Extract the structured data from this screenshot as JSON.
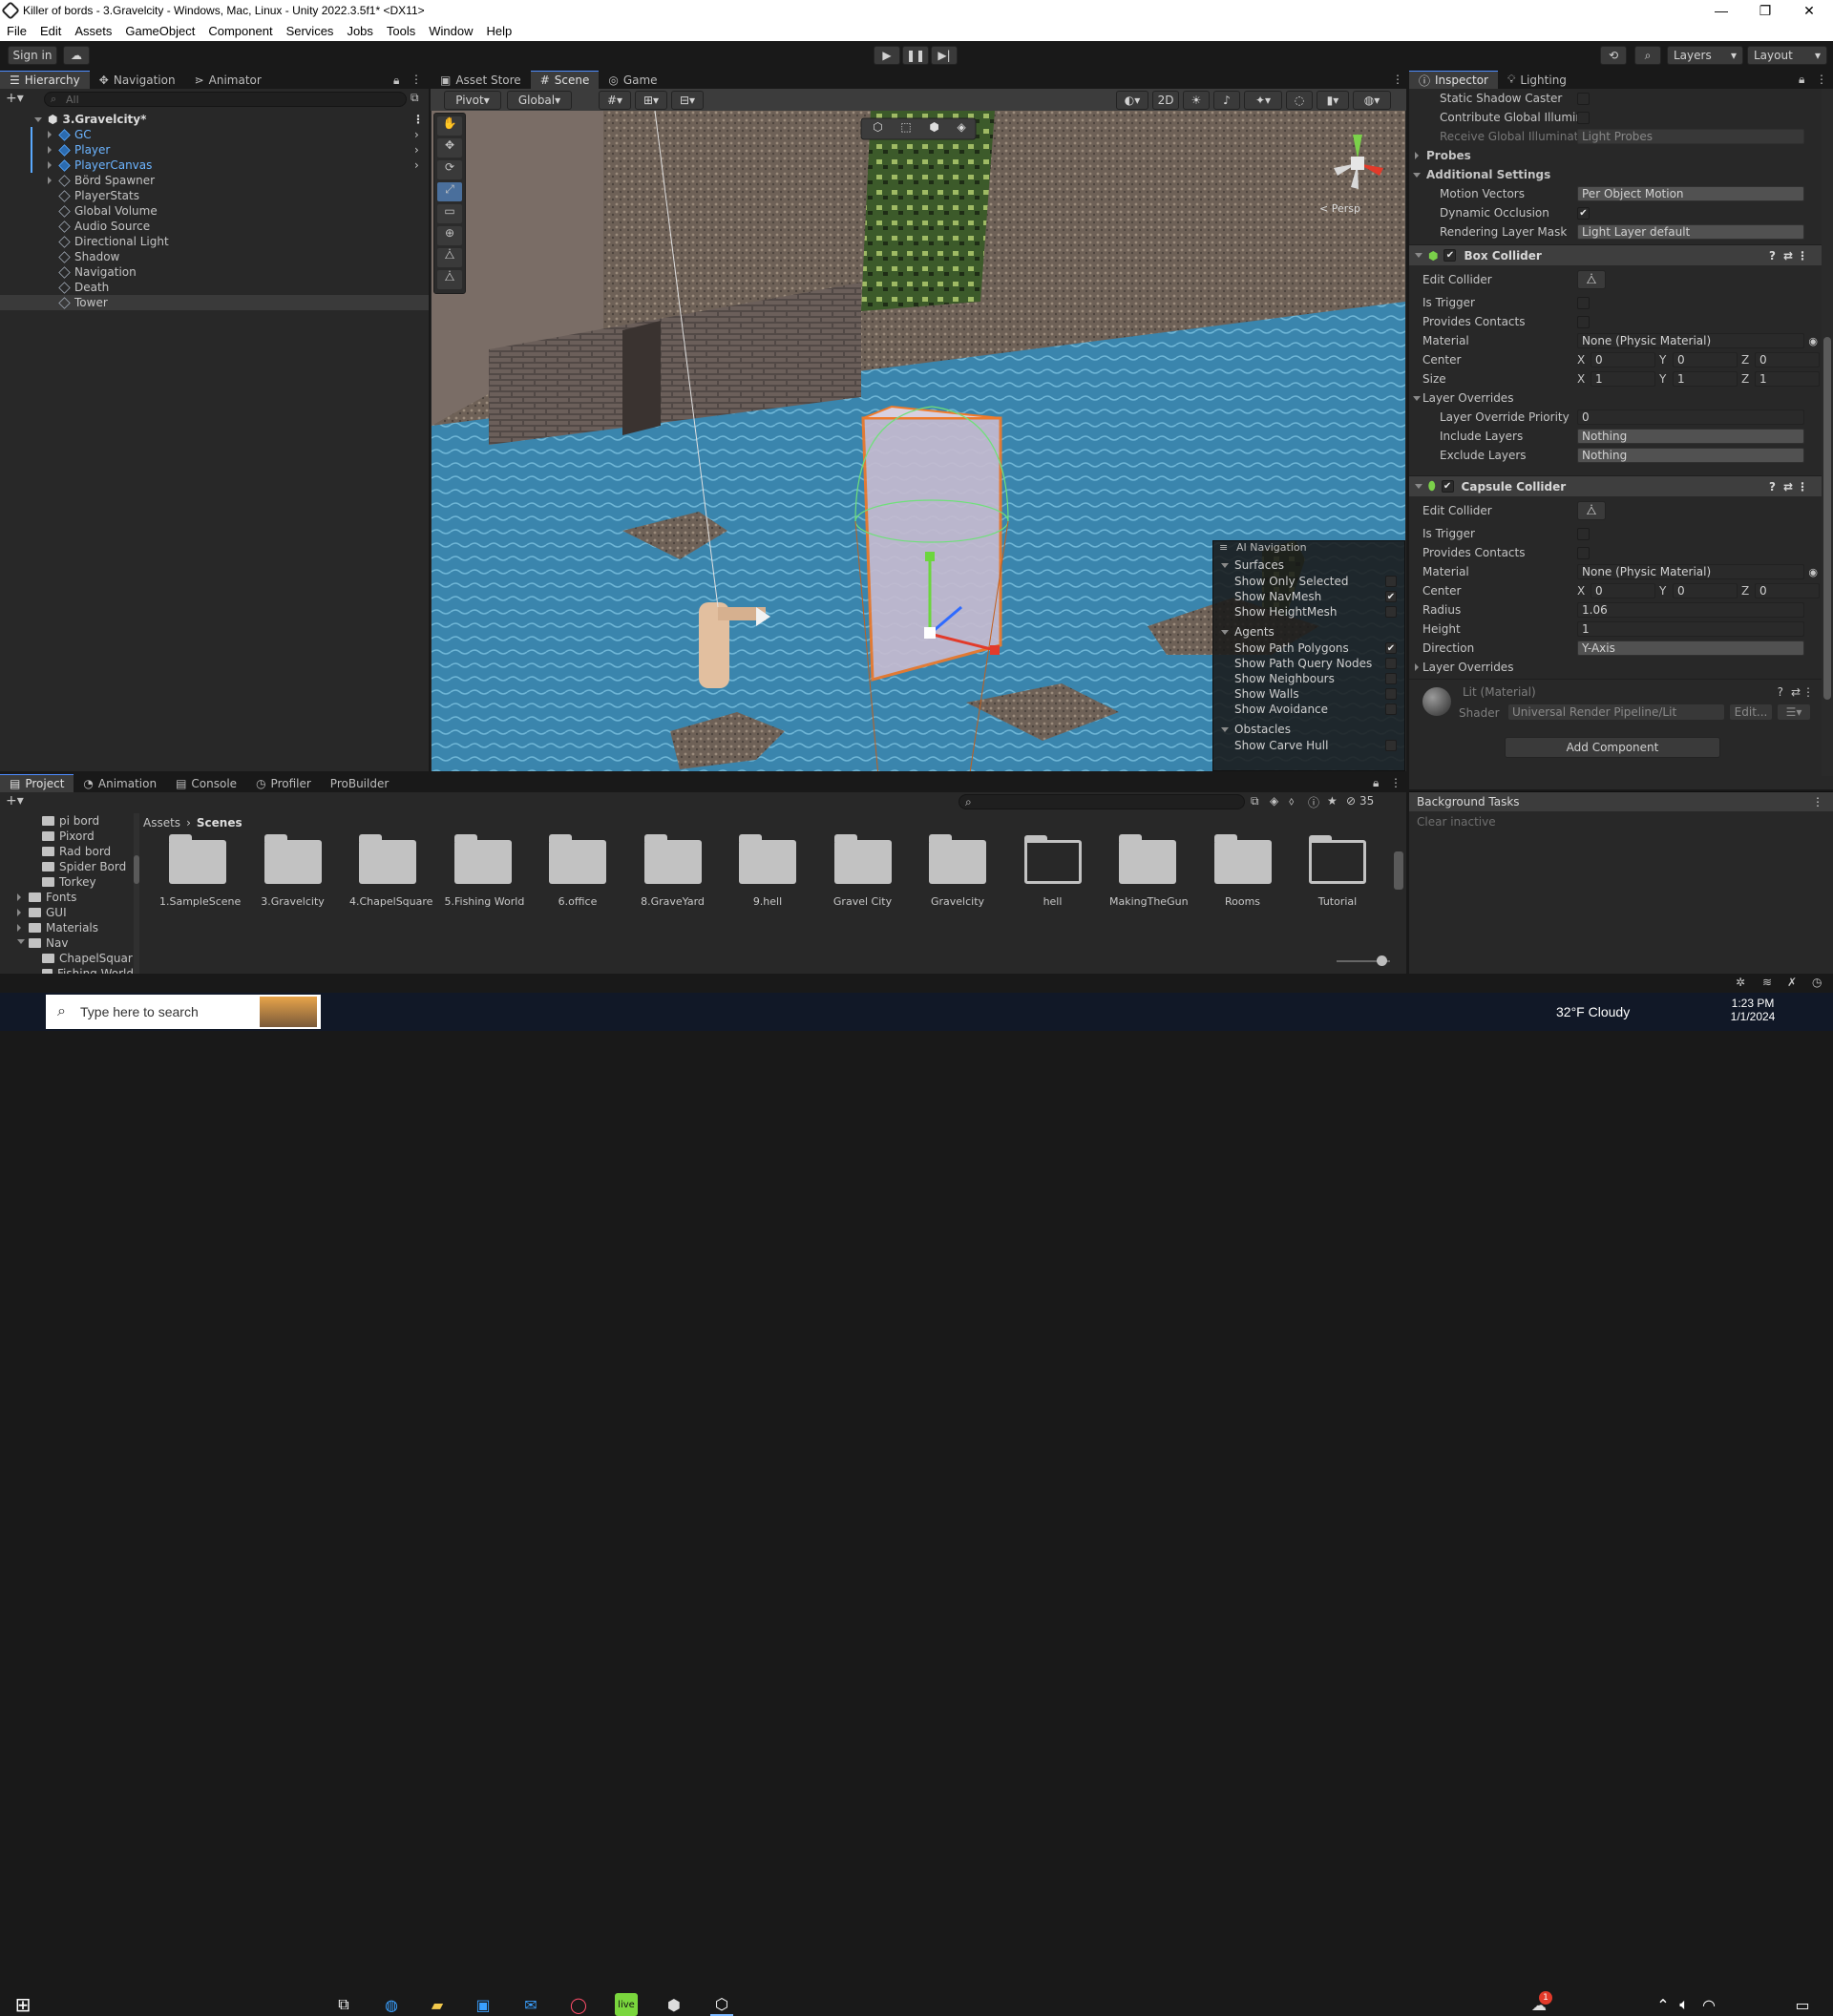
{
  "window": {
    "title": "Killer of bords - 3.Gravelcity - Windows, Mac, Linux - Unity 2022.3.5f1* <DX11>",
    "controls": [
      "—",
      "❐",
      "✕"
    ]
  },
  "menu": [
    "File",
    "Edit",
    "Assets",
    "GameObject",
    "Component",
    "Services",
    "Jobs",
    "Tools",
    "Window",
    "Help"
  ],
  "toolbar": {
    "sign_in": "Sign in",
    "layers": "Layers",
    "layout": "Layout"
  },
  "hierarchy": {
    "tabs": [
      "Hierarchy",
      "Navigation",
      "Animator"
    ],
    "search_placeholder": "All",
    "scene_name": "3.Gravelcity*",
    "items": [
      {
        "name": "GC",
        "prefab": true,
        "expandable": true
      },
      {
        "name": "Player",
        "prefab": true,
        "expandable": true
      },
      {
        "name": "PlayerCanvas",
        "prefab": true,
        "expandable": true
      },
      {
        "name": "Börd Spawner",
        "prefab": false,
        "expandable": true
      },
      {
        "name": "PlayerStats",
        "prefab": false,
        "expandable": false
      },
      {
        "name": "Global Volume",
        "prefab": false,
        "expandable": false
      },
      {
        "name": "Audio Source",
        "prefab": false,
        "expandable": false
      },
      {
        "name": "Directional Light",
        "prefab": false,
        "expandable": false
      },
      {
        "name": "Shadow",
        "prefab": false,
        "expandable": false
      },
      {
        "name": "Navigation",
        "prefab": false,
        "expandable": false
      },
      {
        "name": "Death",
        "prefab": false,
        "expandable": false
      },
      {
        "name": "Tower",
        "prefab": false,
        "expandable": false,
        "selected": true
      }
    ]
  },
  "scene": {
    "tabs": [
      "Asset Store",
      "Scene",
      "Game"
    ],
    "pivot": "Pivot",
    "global": "Global",
    "mode_2d": "2D",
    "persp": "< Persp"
  },
  "ai_navigation": {
    "title": "AI Navigation",
    "sections": [
      {
        "name": "Surfaces",
        "items": [
          {
            "label": "Show Only Selected",
            "checked": false
          },
          {
            "label": "Show NavMesh",
            "checked": true
          },
          {
            "label": "Show HeightMesh",
            "checked": false
          }
        ]
      },
      {
        "name": "Agents",
        "items": [
          {
            "label": "Show Path Polygons",
            "checked": true
          },
          {
            "label": "Show Path Query Nodes",
            "checked": false
          },
          {
            "label": "Show Neighbours",
            "checked": false
          },
          {
            "label": "Show Walls",
            "checked": false
          },
          {
            "label": "Show Avoidance",
            "checked": false
          }
        ]
      },
      {
        "name": "Obstacles",
        "items": [
          {
            "label": "Show Carve Hull",
            "checked": false
          }
        ]
      }
    ]
  },
  "inspector": {
    "tabs": [
      "Inspector",
      "Lighting"
    ],
    "rows_top": {
      "static_shadow": "Static Shadow Caster",
      "contribute_gi": "Contribute Global Illumin",
      "receive_gi": "Receive Global Illuminati",
      "receive_gi_value": "Light Probes",
      "probes": "Probes",
      "additional_settings": "Additional Settings",
      "motion_vectors": "Motion Vectors",
      "motion_vectors_value": "Per Object Motion",
      "dynamic_occlusion": "Dynamic Occlusion",
      "rendering_layer_mask": "Rendering Layer Mask",
      "rendering_layer_mask_value": "Light Layer default"
    },
    "box_collider": {
      "title": "Box Collider",
      "edit_collider": "Edit Collider",
      "is_trigger": "Is Trigger",
      "provides_contacts": "Provides Contacts",
      "material": "Material",
      "material_value": "None (Physic Material)",
      "center": "Center",
      "center_values": {
        "x": "0",
        "y": "0",
        "z": "0"
      },
      "size": "Size",
      "size_values": {
        "x": "1",
        "y": "1",
        "z": "1"
      },
      "layer_overrides": "Layer Overrides",
      "layer_override_priority": "Layer Override Priority",
      "layer_override_priority_value": "0",
      "include_layers": "Include Layers",
      "include_layers_value": "Nothing",
      "exclude_layers": "Exclude Layers",
      "exclude_layers_value": "Nothing"
    },
    "capsule_collider": {
      "title": "Capsule Collider",
      "edit_collider": "Edit Collider",
      "is_trigger": "Is Trigger",
      "provides_contacts": "Provides Contacts",
      "material": "Material",
      "material_value": "None (Physic Material)",
      "center": "Center",
      "center_values": {
        "x": "0",
        "y": "0",
        "z": "0"
      },
      "radius": "Radius",
      "radius_value": "1.06",
      "height": "Height",
      "height_value": "1",
      "direction": "Direction",
      "direction_value": "Y-Axis",
      "layer_overrides": "Layer Overrides"
    },
    "material": {
      "name": "Lit (Material)",
      "shader_label": "Shader",
      "shader_value": "Universal Render Pipeline/Lit",
      "edit": "Edit..."
    },
    "add_component": "Add Component",
    "axis_labels": {
      "x": "X",
      "y": "Y",
      "z": "Z"
    }
  },
  "background_tasks": {
    "title": "Background Tasks",
    "clear_inactive": "Clear inactive"
  },
  "project": {
    "tabs": [
      "Project",
      "Animation",
      "Console",
      "Profiler",
      "ProBuilder"
    ],
    "hidden_count": "35",
    "breadcrumb": [
      "Assets",
      "Scenes"
    ],
    "tree": [
      {
        "name": "pi bord",
        "indent": 2
      },
      {
        "name": "Pixord",
        "indent": 2
      },
      {
        "name": "Rad bord",
        "indent": 2
      },
      {
        "name": "Spider Bord",
        "indent": 2
      },
      {
        "name": "Torkey",
        "indent": 2
      },
      {
        "name": "Fonts",
        "indent": 1
      },
      {
        "name": "GUI",
        "indent": 1
      },
      {
        "name": "Materials",
        "indent": 1
      },
      {
        "name": "Nav",
        "indent": 1
      },
      {
        "name": "ChapelSquar",
        "indent": 2
      },
      {
        "name": "Fishing World",
        "indent": 2
      }
    ],
    "folders": [
      {
        "name": "1.SampleScene",
        "empty": false
      },
      {
        "name": "3.Gravelcity",
        "empty": false
      },
      {
        "name": "4.ChapelSquare",
        "empty": false
      },
      {
        "name": "5.Fishing World",
        "empty": false
      },
      {
        "name": "6.office",
        "empty": false
      },
      {
        "name": "8.GraveYard",
        "empty": false
      },
      {
        "name": "9.hell",
        "empty": false
      },
      {
        "name": "Gravel City",
        "empty": false
      },
      {
        "name": "Gravelcity",
        "empty": false
      },
      {
        "name": "hell",
        "empty": true
      },
      {
        "name": "MakingTheGun",
        "empty": false
      },
      {
        "name": "Rooms",
        "empty": false
      },
      {
        "name": "Tutorial",
        "empty": true
      }
    ]
  },
  "taskbar": {
    "search_placeholder": "Type here to search",
    "weather": "32°F  Cloudy",
    "time": "1:23 PM",
    "date": "1/1/2024",
    "notification_count": "1"
  },
  "colors": {
    "accent": "#4d8cff",
    "prefab": "#6cb4ff",
    "selection": "#2c5d87",
    "water": "#3d7fa3"
  }
}
